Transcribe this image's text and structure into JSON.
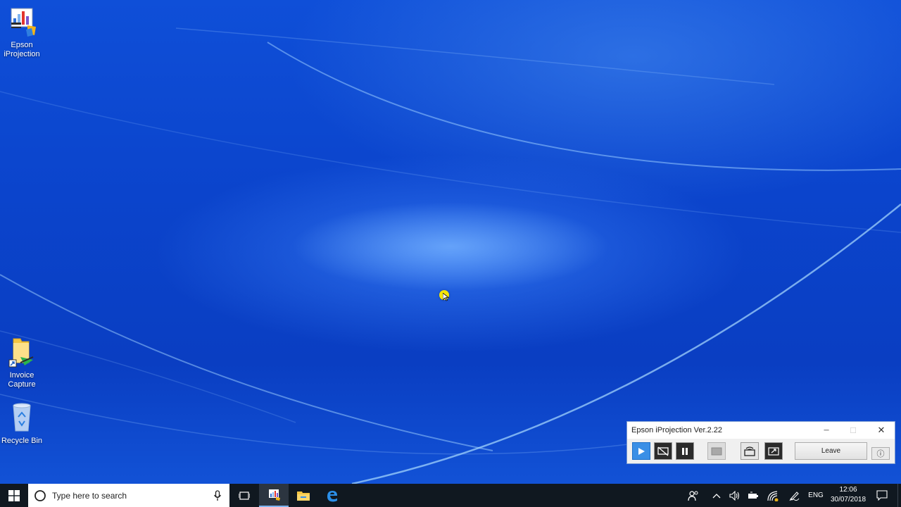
{
  "desktop": {
    "icons": [
      {
        "label_line1": "Epson",
        "label_line2": "iProjection",
        "icon": "epson-iprojection-icon"
      },
      {
        "label_line1": "Invoice",
        "label_line2": "Capture",
        "icon": "folder-shortcut-icon"
      },
      {
        "label_line1": "Recycle Bin",
        "label_line2": "",
        "icon": "recycle-bin-icon"
      }
    ]
  },
  "epson_window": {
    "title": "Epson iProjection Ver.2.22",
    "minimize": "─",
    "maximize": "☐",
    "close": "✕",
    "leave_label": "Leave",
    "info_label": "ⓘ",
    "tools": [
      "play-icon",
      "no-display-icon",
      "pause-icon",
      "blank-screen-icon",
      "wireless-project-icon",
      "fit-screen-icon"
    ]
  },
  "taskbar": {
    "search_placeholder": "Type here to search",
    "language": "ENG",
    "time": "12:06",
    "date": "30/07/2018"
  },
  "colors": {
    "desktop_blue": "#0a40c8",
    "taskbar": "#101820",
    "accent": "#2b8fe8",
    "cursor_highlight": "#f5e60a"
  }
}
